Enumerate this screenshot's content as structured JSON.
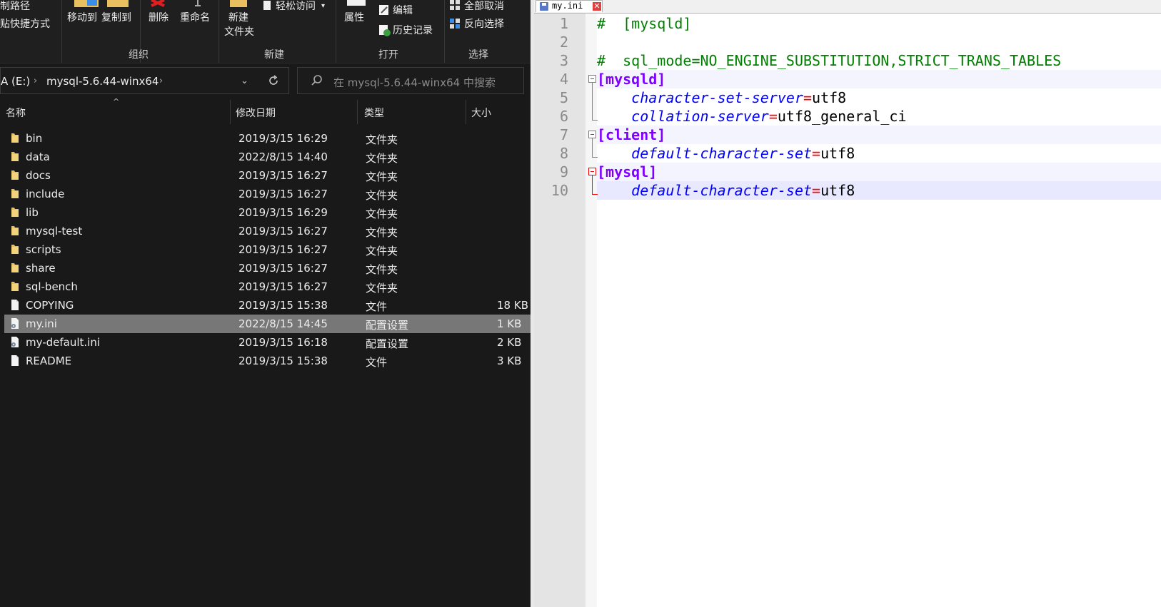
{
  "explorer": {
    "ribbon": {
      "copy_path": "制路径",
      "paste_shortcut": "贴快捷方式",
      "move_to": "移动到",
      "copy_to": "复制到",
      "delete": "删除",
      "rename": "重命名",
      "new_folder_line1": "新建",
      "new_folder_line2": "文件夹",
      "easy_access": "轻松访问",
      "properties": "属性",
      "edit": "编辑",
      "history": "历史记录",
      "select_all": "全部取消",
      "invert_selection": "反向选择",
      "groups": [
        "组织",
        "新建",
        "打开",
        "选择"
      ]
    },
    "address": {
      "drive": "A (E:)",
      "folder": "mysql-5.6.44-winx64",
      "search_placeholder": "在 mysql-5.6.44-winx64 中搜索"
    },
    "columns": [
      "名称",
      "修改日期",
      "类型",
      "大小"
    ],
    "files": [
      {
        "name": "bin",
        "date": "2019/3/15 16:29",
        "type": "文件夹",
        "size": "",
        "icon": "folder-icon"
      },
      {
        "name": "data",
        "date": "2022/8/15 14:40",
        "type": "文件夹",
        "size": "",
        "icon": "folder-icon"
      },
      {
        "name": "docs",
        "date": "2019/3/15 16:27",
        "type": "文件夹",
        "size": "",
        "icon": "folder-icon"
      },
      {
        "name": "include",
        "date": "2019/3/15 16:27",
        "type": "文件夹",
        "size": "",
        "icon": "folder-icon"
      },
      {
        "name": "lib",
        "date": "2019/3/15 16:29",
        "type": "文件夹",
        "size": "",
        "icon": "folder-icon"
      },
      {
        "name": "mysql-test",
        "date": "2019/3/15 16:27",
        "type": "文件夹",
        "size": "",
        "icon": "folder-icon"
      },
      {
        "name": "scripts",
        "date": "2019/3/15 16:27",
        "type": "文件夹",
        "size": "",
        "icon": "folder-icon"
      },
      {
        "name": "share",
        "date": "2019/3/15 16:27",
        "type": "文件夹",
        "size": "",
        "icon": "folder-icon"
      },
      {
        "name": "sql-bench",
        "date": "2019/3/15 16:27",
        "type": "文件夹",
        "size": "",
        "icon": "folder-icon"
      },
      {
        "name": "COPYING",
        "date": "2019/3/15 15:38",
        "type": "文件",
        "size": "18 KB",
        "icon": "file-icon"
      },
      {
        "name": "my.ini",
        "date": "2022/8/15 14:45",
        "type": "配置设置",
        "size": "1 KB",
        "icon": "settings-file-icon",
        "selected": true
      },
      {
        "name": "my-default.ini",
        "date": "2019/3/15 16:18",
        "type": "配置设置",
        "size": "2 KB",
        "icon": "settings-file-icon"
      },
      {
        "name": "README",
        "date": "2019/3/15 15:38",
        "type": "文件",
        "size": "3 KB",
        "icon": "file-icon"
      }
    ]
  },
  "editor": {
    "tab_title": "my.ini",
    "lines": [
      {
        "num": "1",
        "tokens": [
          [
            "c-com",
            "#  [mysqld]"
          ]
        ]
      },
      {
        "num": "2",
        "tokens": []
      },
      {
        "num": "3",
        "tokens": [
          [
            "c-com",
            "#  sql_mode=NO_ENGINE_SUBSTITUTION,STRICT_TRANS_TABLES"
          ]
        ]
      },
      {
        "num": "4",
        "tokens": [
          [
            "c-sec",
            "[mysqld]"
          ]
        ]
      },
      {
        "num": "5",
        "tokens": [
          [
            "c-val",
            "    "
          ],
          [
            "c-key",
            "character-set-server"
          ],
          [
            "c-eq",
            "="
          ],
          [
            "c-val",
            "utf8"
          ]
        ]
      },
      {
        "num": "6",
        "tokens": [
          [
            "c-val",
            "    "
          ],
          [
            "c-key",
            "collation-server"
          ],
          [
            "c-eq",
            "="
          ],
          [
            "c-val",
            "utf8_general_ci"
          ]
        ]
      },
      {
        "num": "7",
        "tokens": [
          [
            "c-sec",
            "[client]"
          ]
        ]
      },
      {
        "num": "8",
        "tokens": [
          [
            "c-val",
            "    "
          ],
          [
            "c-key",
            "default-character-set"
          ],
          [
            "c-eq",
            "="
          ],
          [
            "c-val",
            "utf8"
          ]
        ]
      },
      {
        "num": "9",
        "tokens": [
          [
            "c-sec",
            "[mysql]"
          ]
        ]
      },
      {
        "num": "10",
        "tokens": [
          [
            "c-val",
            "    "
          ],
          [
            "c-key",
            "default-character-set"
          ],
          [
            "c-eq",
            "="
          ],
          [
            "c-val",
            "utf8"
          ]
        ]
      }
    ]
  }
}
